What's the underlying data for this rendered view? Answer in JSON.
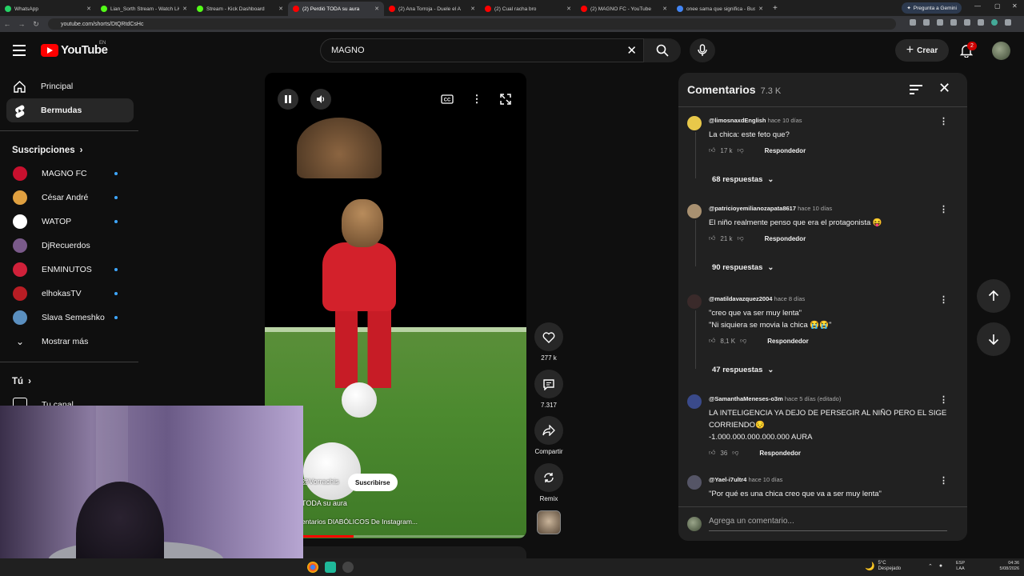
{
  "browser": {
    "tabs": [
      {
        "label": "WhatsApp",
        "color": "#25d366",
        "active": false
      },
      {
        "label": "Lian_Sorth Stream - Watch Live",
        "color": "#53fc18",
        "active": false
      },
      {
        "label": "Stream - Kick Dashboard",
        "color": "#53fc18",
        "active": false
      },
      {
        "label": "(2) Perdió TODA su aura",
        "color": "#ff0000",
        "active": true
      },
      {
        "label": "(2) Ana Torroja - Duele el A",
        "color": "#ff0000",
        "active": false
      },
      {
        "label": "(2) Cual racha bro",
        "color": "#ff0000",
        "active": false
      },
      {
        "label": "(2) MAGNO FC - YouTube",
        "color": "#ff0000",
        "active": false
      },
      {
        "label": "onee sama que significa - Busc",
        "color": "#4285f4",
        "active": false
      }
    ],
    "new_tab": "+",
    "gemini_label": "Pregunta a Gemini",
    "url": "youtube.com/shorts/DtQRtdCsHc"
  },
  "header": {
    "logo_text": "YouTube",
    "country": "EN",
    "search_value": "MAGNO",
    "create_label": "Crear",
    "notification_count": "2"
  },
  "sidebar": {
    "main": [
      {
        "label": "Principal",
        "icon": "home-icon"
      },
      {
        "label": "Bermudas",
        "icon": "shorts-icon"
      }
    ],
    "subs_title": "Suscripciones",
    "subscriptions": [
      {
        "label": "MAGNO FC",
        "color": "#c8102e",
        "dot": true
      },
      {
        "label": "César André",
        "color": "#e0a040",
        "dot": true
      },
      {
        "label": "WATOP",
        "color": "#ffffff",
        "dot": true
      },
      {
        "label": "DjRecuerdos",
        "color": "#7a5a8a",
        "dot": false
      },
      {
        "label": "ENMINUTOS",
        "color": "#d0213a",
        "dot": true
      },
      {
        "label": "elhokasTV",
        "color": "#b81d24",
        "dot": true
      },
      {
        "label": "Slava Semeshko",
        "color": "#5a8fbf",
        "dot": true
      }
    ],
    "show_more": "Mostrar más",
    "you_title": "Tú",
    "your_channel": "Tu canal"
  },
  "player": {
    "channel": "@Vorrachis",
    "subscribe": "Suscribirse",
    "title": "TODA su aura",
    "sound": "entarios DIABÓLICOS De Instagram...",
    "progress": 0.34
  },
  "actions": {
    "likes": "277 k",
    "comments": "7.317",
    "share": "Compartir",
    "remix": "Remix"
  },
  "comments": {
    "title": "Comentarios",
    "count": "7.3 K",
    "items": [
      {
        "user": "@limosnaxdEnglish",
        "time": "hace 10 días",
        "text": "La chica: este feto que?",
        "likes": "17 k",
        "reply": "Respondedor",
        "replies": "68 respuestas",
        "color": "#e8c84a"
      },
      {
        "user": "@patricioyemilianozapata8617",
        "time": "hace 10 días",
        "text": "El niño realmente penso que era el protagonista 😝",
        "likes": "21 k",
        "reply": "Respondedor",
        "replies": "90 respuestas",
        "color": "#a89070"
      },
      {
        "user": "@matildavazquez2004",
        "time": "hace 8 días",
        "text": "\"creo que va ser muy lenta\"\n\"Ni siquiera se movia la chica 😭😭\"",
        "likes": "8,1 K",
        "reply": "Respondedor",
        "replies": "47 respuestas",
        "color": "#3a2a2a"
      },
      {
        "user": "@SamanthaMeneses-o3m",
        "time": "hace 5 días (editado)",
        "text": "LA INTELIGENCIA YA DEJO DE PERSEGIR AL NIÑO PERO EL SIGE CORRIENDO😔\n-1.000.000.000.000.000 AURA",
        "likes": "36",
        "reply": "Respondedor",
        "replies": "",
        "color": "#3a4a8a"
      },
      {
        "user": "@Yael-i7ultr4",
        "time": "hace 10 días",
        "text": "\"Por qué es una chica creo que va a ser muy lenta\"",
        "likes": "",
        "reply": "",
        "replies": "",
        "color": "#555566"
      }
    ],
    "add_placeholder": "Agrega un comentario..."
  },
  "taskbar": {
    "temp": "5°C",
    "weather": "Despejado",
    "lang1": "ESP",
    "lang2": "LAA",
    "time": "04:36",
    "date": "5/08/2026"
  }
}
